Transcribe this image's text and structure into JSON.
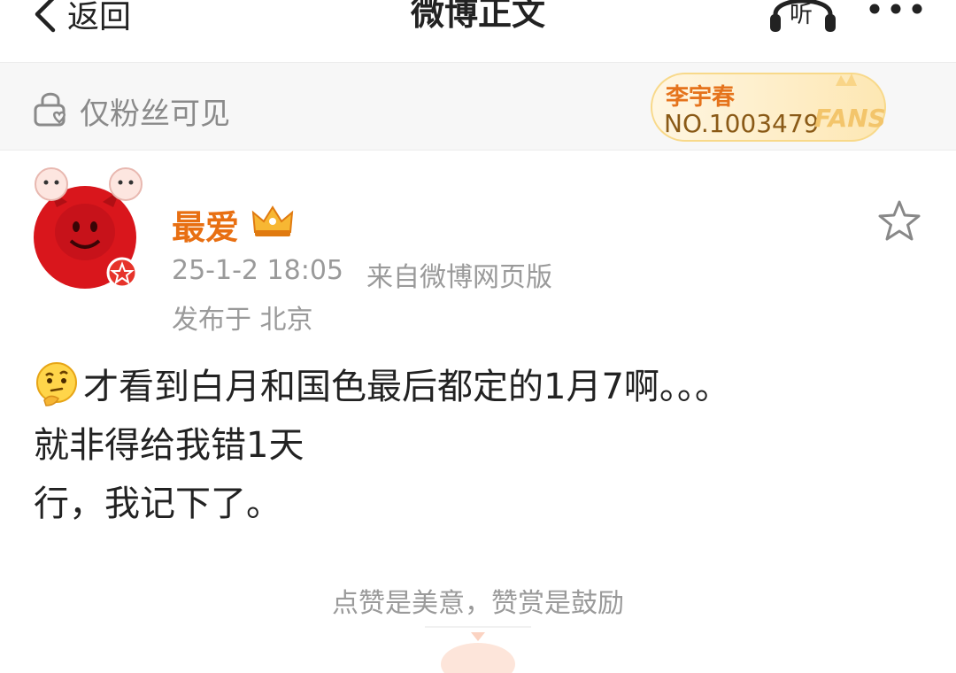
{
  "header": {
    "back_label": "返回",
    "title": "微博正文",
    "listen_label": "听"
  },
  "visibility": {
    "label": "仅粉丝可见"
  },
  "fans_badge": {
    "name": "李宇春",
    "number": "NO.1003479",
    "fans_word": "FANS"
  },
  "post": {
    "author": "最爱",
    "time": "25-1-2 18:05",
    "source": "来自微博网页版",
    "location": "发布于 北京",
    "lines": [
      "才看到白月和国色最后都定的1月7啊。。。",
      "就非得给我错1天",
      "行，我记下了。"
    ]
  },
  "reward": {
    "label": "点赞是美意，赞赏是鼓励"
  },
  "colors": {
    "accent_orange": "#e86f12",
    "muted_text": "#9a9a9a",
    "avatar_red": "#d9161c"
  },
  "icons": {
    "back": "chevron-left-icon",
    "listen": "headphones-icon",
    "more": "more-dots-icon",
    "lock": "lock-heart-icon",
    "crown": "crown-badge-icon",
    "star": "star-outline-icon",
    "emoji": "thinking-emoji-icon"
  }
}
